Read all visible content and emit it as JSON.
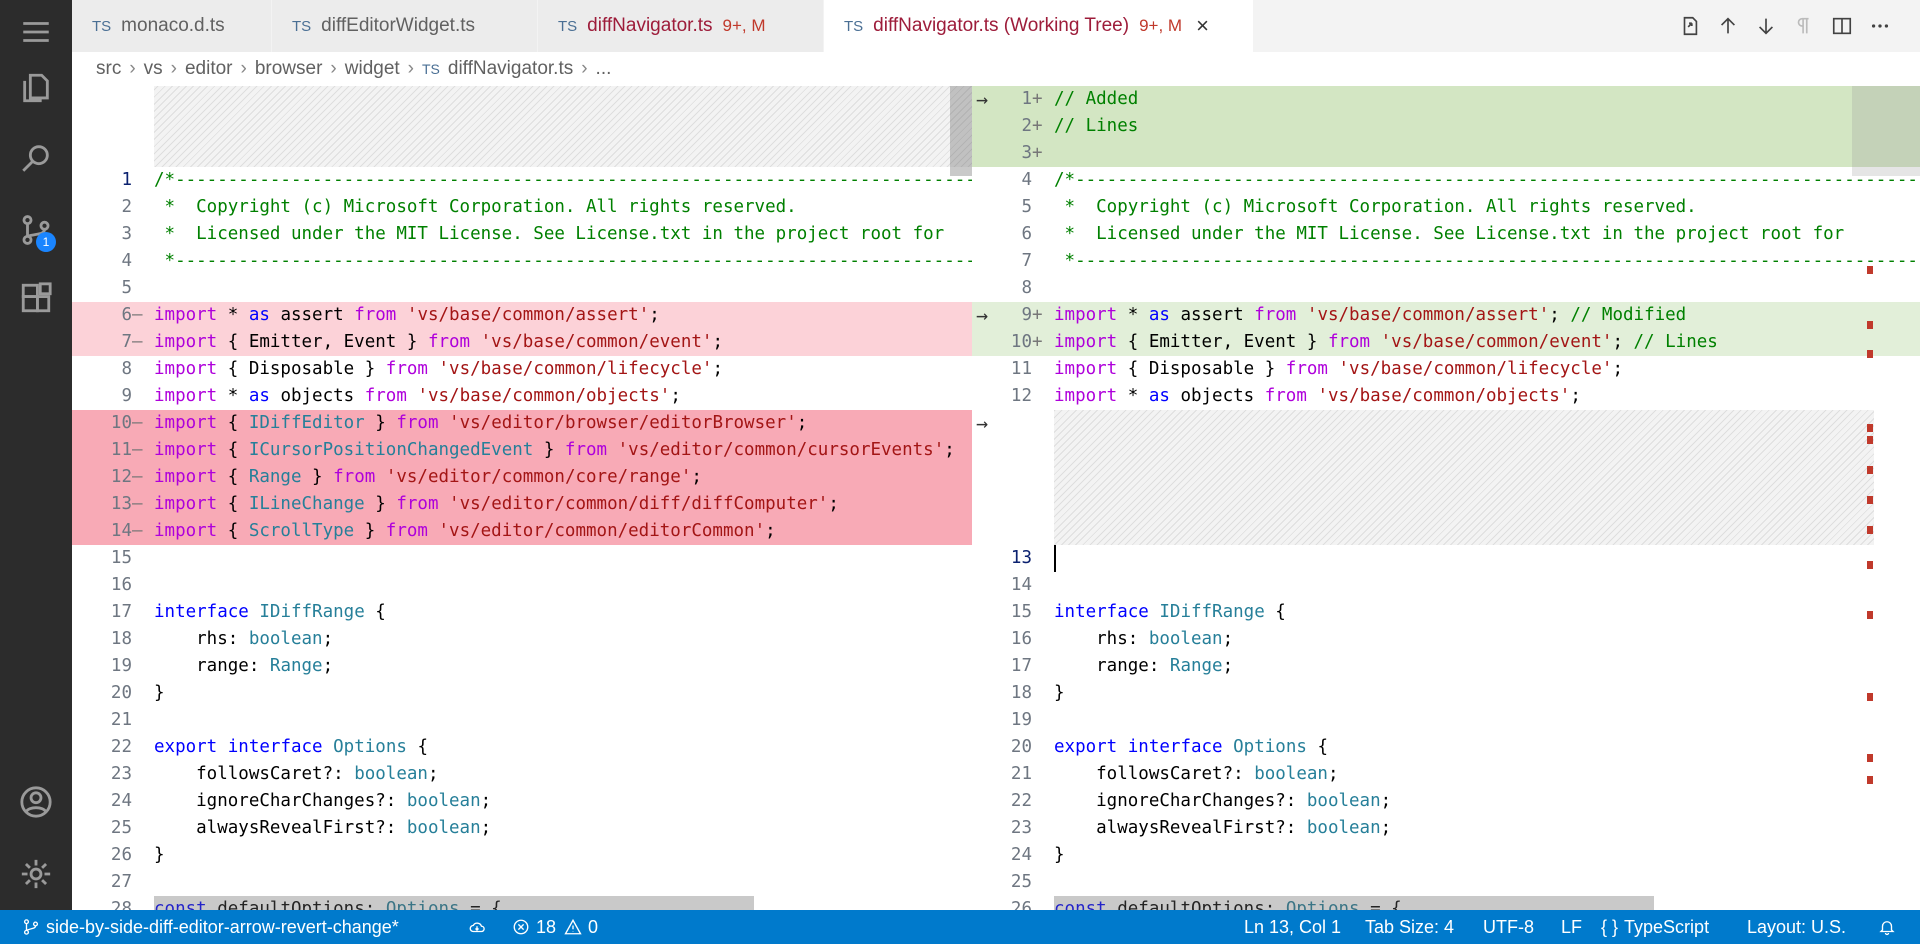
{
  "tabs": [
    {
      "icon": "TS",
      "name": "monaco.d.ts",
      "state": "",
      "active": false
    },
    {
      "icon": "TS",
      "name": "diffEditorWidget.ts",
      "state": "",
      "active": false
    },
    {
      "icon": "TS",
      "name": "diffNavigator.ts",
      "state": "9+, M",
      "active": false
    },
    {
      "icon": "TS",
      "name": "diffNavigator.ts (Working Tree)",
      "state": "9+, M",
      "active": true
    }
  ],
  "breadcrumb": [
    "src",
    "vs",
    "editor",
    "browser",
    "widget",
    "diffNavigator.ts",
    "..."
  ],
  "breadcrumb_file_icon": "TS",
  "activity_badge": "1",
  "left_lines": [
    {
      "n": "1",
      "m": "",
      "t": "/*-----------------------------------------------------------------------------------------"
    },
    {
      "n": "2",
      "m": "",
      "t": " *  Copyright (c) Microsoft Corporation. All rights reserved."
    },
    {
      "n": "3",
      "m": "",
      "t": " *  Licensed under the MIT License. See License.txt in the project root for"
    },
    {
      "n": "4",
      "m": "",
      "t": " *-----------------------------------------------------------------------------------------"
    },
    {
      "n": "5",
      "m": "",
      "t": ""
    },
    {
      "n": "6",
      "m": "—",
      "t": "import * as assert from 'vs/base/common/assert';"
    },
    {
      "n": "7",
      "m": "—",
      "t": "import { Emitter, Event } from 'vs/base/common/event';"
    },
    {
      "n": "8",
      "m": "",
      "t": "import { Disposable } from 'vs/base/common/lifecycle';"
    },
    {
      "n": "9",
      "m": "",
      "t": "import * as objects from 'vs/base/common/objects';"
    },
    {
      "n": "10",
      "m": "—",
      "t": "import { IDiffEditor } from 'vs/editor/browser/editorBrowser';"
    },
    {
      "n": "11",
      "m": "—",
      "t": "import { ICursorPositionChangedEvent } from 'vs/editor/common/cursorEvents';"
    },
    {
      "n": "12",
      "m": "—",
      "t": "import { Range } from 'vs/editor/common/core/range';"
    },
    {
      "n": "13",
      "m": "—",
      "t": "import { ILineChange } from 'vs/editor/common/diff/diffComputer';"
    },
    {
      "n": "14",
      "m": "—",
      "t": "import { ScrollType } from 'vs/editor/common/editorCommon';"
    },
    {
      "n": "15",
      "m": "",
      "t": ""
    },
    {
      "n": "16",
      "m": "",
      "t": ""
    },
    {
      "n": "17",
      "m": "",
      "t": "interface IDiffRange {"
    },
    {
      "n": "18",
      "m": "",
      "t": "    rhs: boolean;"
    },
    {
      "n": "19",
      "m": "",
      "t": "    range: Range;"
    },
    {
      "n": "20",
      "m": "",
      "t": "}"
    },
    {
      "n": "21",
      "m": "",
      "t": ""
    },
    {
      "n": "22",
      "m": "",
      "t": "export interface Options {"
    },
    {
      "n": "23",
      "m": "",
      "t": "    followsCaret?: boolean;"
    },
    {
      "n": "24",
      "m": "",
      "t": "    ignoreCharChanges?: boolean;"
    },
    {
      "n": "25",
      "m": "",
      "t": "    alwaysRevealFirst?: boolean;"
    },
    {
      "n": "26",
      "m": "",
      "t": "}"
    },
    {
      "n": "27",
      "m": "",
      "t": ""
    },
    {
      "n": "28",
      "m": "",
      "t": "const defaultOptions: Options = {"
    }
  ],
  "right_lines": [
    {
      "n": "1",
      "m": "+",
      "t": "// Added"
    },
    {
      "n": "2",
      "m": "+",
      "t": "// Lines"
    },
    {
      "n": "3",
      "m": "+",
      "t": ""
    },
    {
      "n": "4",
      "m": "",
      "t": "/*-----------------------------------------------------------------------------------------"
    },
    {
      "n": "5",
      "m": "",
      "t": " *  Copyright (c) Microsoft Corporation. All rights reserved."
    },
    {
      "n": "6",
      "m": "",
      "t": " *  Licensed under the MIT License. See License.txt in the project root for"
    },
    {
      "n": "7",
      "m": "",
      "t": " *-----------------------------------------------------------------------------------------"
    },
    {
      "n": "8",
      "m": "",
      "t": ""
    },
    {
      "n": "9",
      "m": "+",
      "t": "import * as assert from 'vs/base/common/assert'; // Modified"
    },
    {
      "n": "10",
      "m": "+",
      "t": "import { Emitter, Event } from 'vs/base/common/event'; // Lines"
    },
    {
      "n": "11",
      "m": "",
      "t": "import { Disposable } from 'vs/base/common/lifecycle';"
    },
    {
      "n": "12",
      "m": "",
      "t": "import * as objects from 'vs/base/common/objects';"
    },
    {
      "n": "13",
      "m": "",
      "t": ""
    },
    {
      "n": "14",
      "m": "",
      "t": ""
    },
    {
      "n": "15",
      "m": "",
      "t": "interface IDiffRange {"
    },
    {
      "n": "16",
      "m": "",
      "t": "    rhs: boolean;"
    },
    {
      "n": "17",
      "m": "",
      "t": "    range: Range;"
    },
    {
      "n": "18",
      "m": "",
      "t": "}"
    },
    {
      "n": "19",
      "m": "",
      "t": ""
    },
    {
      "n": "20",
      "m": "",
      "t": "export interface Options {"
    },
    {
      "n": "21",
      "m": "",
      "t": "    followsCaret?: boolean;"
    },
    {
      "n": "22",
      "m": "",
      "t": "    ignoreCharChanges?: boolean;"
    },
    {
      "n": "23",
      "m": "",
      "t": "    alwaysRevealFirst?: boolean;"
    },
    {
      "n": "24",
      "m": "",
      "t": "}"
    },
    {
      "n": "25",
      "m": "",
      "t": ""
    },
    {
      "n": "26",
      "m": "",
      "t": "const defaultOptions: Options = {"
    }
  ],
  "revert_arrow": "→",
  "status": {
    "branch": "side-by-side-diff-editor-arrow-revert-change*",
    "errors": "18",
    "warnings": "0",
    "position": "Ln 13, Col 1",
    "tab_size": "Tab Size: 4",
    "encoding": "UTF-8",
    "eol": "LF",
    "language_icon": "{ }",
    "language": "TypeScript",
    "layout": "Layout: U.S."
  },
  "colors": {
    "deleted_line": "#fcd2d8",
    "deleted_line_strong": "#f8aab6",
    "inserted_line": "#e2efd9",
    "status_bar": "#007acc",
    "activity_bar": "#2c2c2c"
  }
}
